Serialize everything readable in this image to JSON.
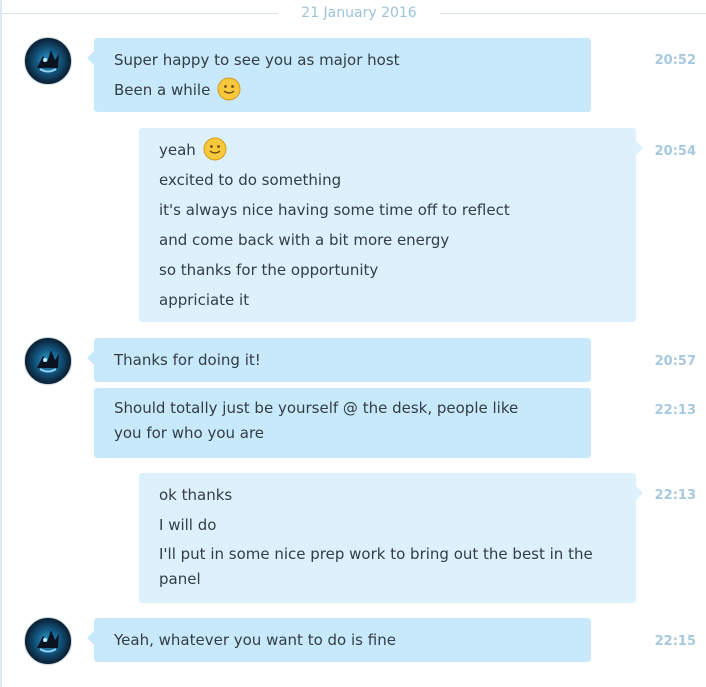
{
  "date_separator": "21 January 2016",
  "messages": [
    {
      "lines": [
        "Super happy to see you as major host",
        "Been a while"
      ],
      "time": "20:52",
      "emoji_after_line": 1
    },
    {
      "lines": [
        "yeah",
        "excited to do something",
        "it's always nice having some time off to reflect",
        "and come back with a bit more energy",
        "so thanks for the opportunity",
        "appriciate it"
      ],
      "time": "20:54",
      "emoji_after_line": 0
    },
    {
      "lines": [
        "Thanks for doing it!"
      ],
      "time": "20:57"
    },
    {
      "lines": [
        "Should totally just be yourself @ the desk, people like you for who you are"
      ],
      "time": "22:13"
    },
    {
      "lines": [
        "ok thanks",
        "I will do",
        "I'll put in some nice prep work to bring out the best in the panel"
      ],
      "time": "22:13"
    },
    {
      "lines": [
        "Yeah, whatever you want to do is fine"
      ],
      "time": "22:15"
    }
  ],
  "icons": {
    "avatar": "contact-avatar-icon",
    "emoji": "smiley-emoji-icon"
  },
  "colors": {
    "incoming_bubble": "#c7e9fb",
    "outgoing_bubble": "#dcf1fc",
    "timestamp": "#a6c9df",
    "text": "#333d44"
  }
}
